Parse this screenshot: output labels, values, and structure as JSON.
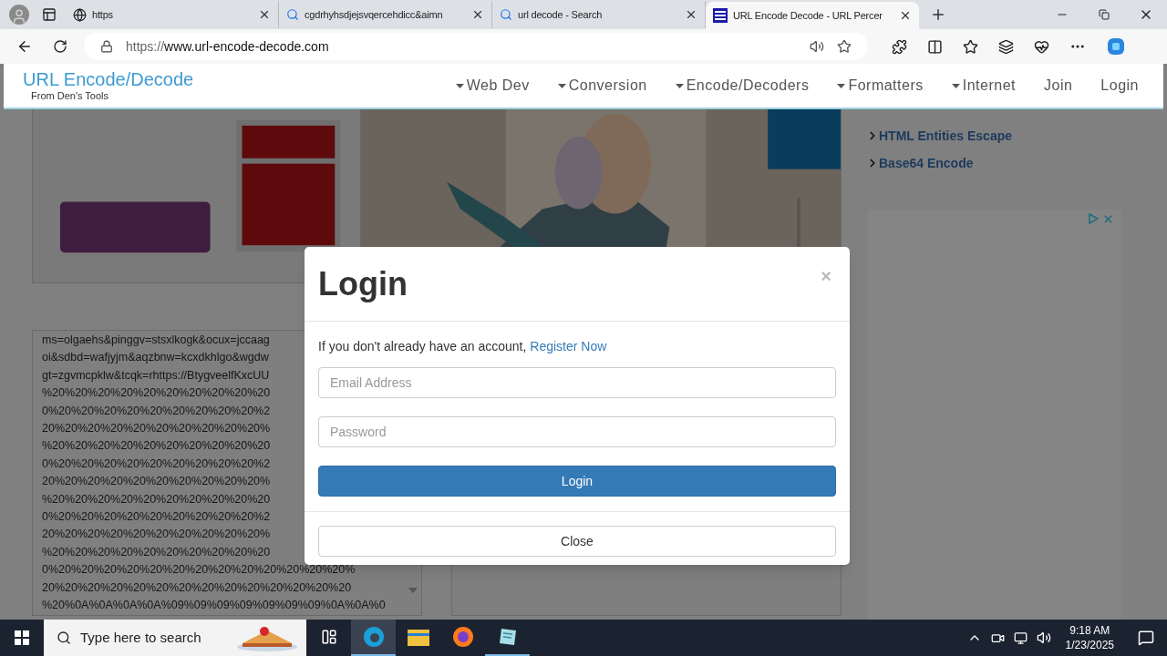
{
  "browser": {
    "tabs": [
      {
        "title": "https",
        "kind": "page",
        "selected": false
      },
      {
        "title": "cgdrhyhsdjejsvqercehdicc&aimn",
        "kind": "search",
        "selected": false
      },
      {
        "title": "url decode - Search",
        "kind": "search",
        "selected": false
      },
      {
        "title": "URL Encode Decode - URL Percer",
        "kind": "site",
        "selected": true
      }
    ],
    "address": {
      "scheme": "https://",
      "host": "www.url-encode-decode.com"
    }
  },
  "site": {
    "logo": "URL Encode/Decode",
    "subtitle": "From Den's Tools",
    "nav": [
      {
        "label": "Web Dev",
        "dropdown": true
      },
      {
        "label": "Conversion",
        "dropdown": true
      },
      {
        "label": "Encode/Decoders",
        "dropdown": true
      },
      {
        "label": "Formatters",
        "dropdown": true
      },
      {
        "label": "Internet",
        "dropdown": true
      },
      {
        "label": "Join",
        "dropdown": false
      },
      {
        "label": "Login",
        "dropdown": false
      }
    ],
    "sidebar_links": [
      "HTML Entities Escape",
      "Base64 Encode"
    ],
    "input_lines": [
      "ms=olgaehs&pinggv=stsxlkogk&ocux=jccaag",
      "oi&sdbd=wafjyjm&aqzbnw=kcxdkhlgo&wgdw",
      "gt=zgvmcpklw&tcqk=rhttps://BtygveelfKxcUU",
      "%20%20%20%20%20%20%20%20%20%20",
      "0%20%20%20%20%20%20%20%20%20%2",
      "20%20%20%20%20%20%20%20%20%20%",
      "%20%20%20%20%20%20%20%20%20%20",
      "0%20%20%20%20%20%20%20%20%20%2",
      "20%20%20%20%20%20%20%20%20%20%",
      "%20%20%20%20%20%20%20%20%20%20",
      "0%20%20%20%20%20%20%20%20%20%2",
      "20%20%20%20%20%20%20%20%20%20%",
      "%20%20%20%20%20%20%20%20%20%20",
      "0%20%20%20%20%20%20%20%20%20%20%20%20%20%",
      "20%20%20%20%20%20%20%20%20%20%20%20%20%20",
      "%20%0A%0A%0A%0A%09%09%09%09%09%09%09%0A%0A%0"
    ]
  },
  "modal": {
    "title": "Login",
    "close_glyph": "×",
    "intro": "If you don't already have an account,",
    "register_link": "Register Now",
    "email_placeholder": "Email Address",
    "password_placeholder": "Password",
    "submit": "Login",
    "close": "Close"
  },
  "taskbar": {
    "search_placeholder": "Type here to search",
    "apps": [
      {
        "kind": "taskview",
        "running": false,
        "selected": false
      },
      {
        "kind": "edge",
        "running": true,
        "selected": true
      },
      {
        "kind": "explorer",
        "running": false,
        "selected": false
      },
      {
        "kind": "firefox",
        "running": false,
        "selected": false
      },
      {
        "kind": "notepad",
        "running": true,
        "selected": false
      }
    ],
    "time": "9:18 AM",
    "date": "1/23/2025"
  }
}
